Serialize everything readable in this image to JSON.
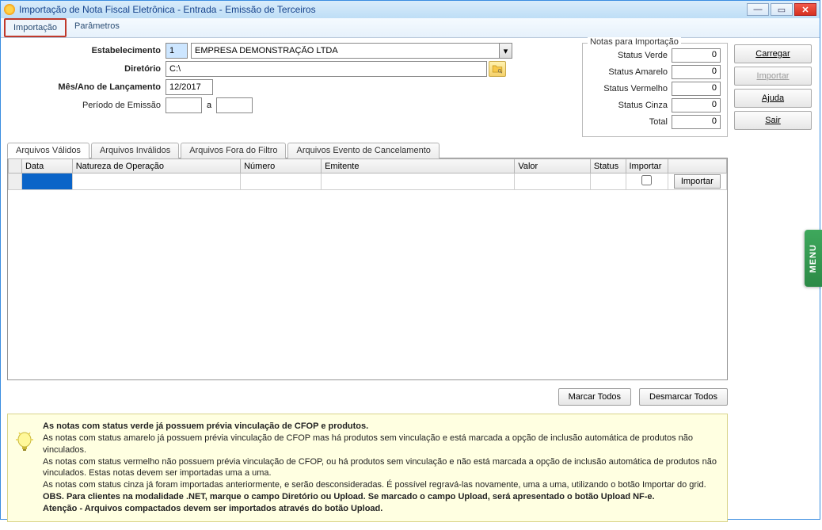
{
  "window": {
    "title": "Importação de Nota Fiscal Eletrônica - Entrada - Emissão de Terceiros"
  },
  "top_tabs": {
    "importacao": "Importação",
    "parametros": "Parâmetros"
  },
  "form": {
    "estabelecimento_label": "Estabelecimento",
    "estabelecimento_code": "1",
    "estabelecimento_name": "EMPRESA DEMONSTRAÇÃO LTDA",
    "diretorio_label": "Diretório",
    "diretorio_value": "C:\\",
    "mesano_label": "Mês/Ano de Lançamento",
    "mesano_value": "12/2017",
    "periodo_label": "Período de Emissão",
    "periodo_a": "a",
    "periodo_from": "",
    "periodo_to": ""
  },
  "notes": {
    "legend": "Notas para Importação",
    "verde_label": "Status Verde",
    "verde": "0",
    "amarelo_label": "Status Amarelo",
    "amarelo": "0",
    "vermelho_label": "Status Vermelho",
    "vermelho": "0",
    "cinza_label": "Status Cinza",
    "cinza": "0",
    "total_label": "Total",
    "total": "0"
  },
  "inner_tabs": {
    "validos": "Arquivos Válidos",
    "invalidos": "Arquivos Inválidos",
    "fora": "Arquivos Fora do Filtro",
    "cancel": "Arquivos Evento de Cancelamento"
  },
  "grid": {
    "col_data": "Data",
    "col_natureza": "Natureza de Operação",
    "col_numero": "Número",
    "col_emitente": "Emitente",
    "col_valor": "Valor",
    "col_status": "Status",
    "col_importar": "Importar",
    "btn_importar": "Importar"
  },
  "mark": {
    "marcar": "Marcar Todos",
    "desmarcar": "Desmarcar Todos"
  },
  "rightbar": {
    "carregar": "Carregar",
    "importar": "Importar",
    "ajuda": "Ajuda",
    "sair": "Sair"
  },
  "menu_tab": "MENU",
  "info": {
    "l1": "As notas com status verde já possuem prévia vinculação de CFOP e produtos.",
    "l2": "As notas com status amarelo já possuem prévia vinculação de CFOP mas há produtos sem vinculação e está marcada a opção de inclusão automática de produtos não vinculados.",
    "l3": "As notas com status vermelho não possuem prévia vinculação de CFOP, ou há produtos sem vinculação e não está marcada a opção de inclusão automática de produtos não vinculados. Estas notas devem ser importadas uma a uma.",
    "l4": "As notas com status cinza já foram importadas anteriormente, e serão desconsideradas. É possível regravá-las novamente, uma a uma, utilizando o botão Importar do grid.",
    "l5": "OBS. Para clientes na modalidade .NET, marque o campo Diretório ou Upload. Se marcado o campo Upload, será apresentado o botão Upload NF-e.",
    "l6": "Atenção - Arquivos compactados devem ser importados através do botão Upload."
  }
}
